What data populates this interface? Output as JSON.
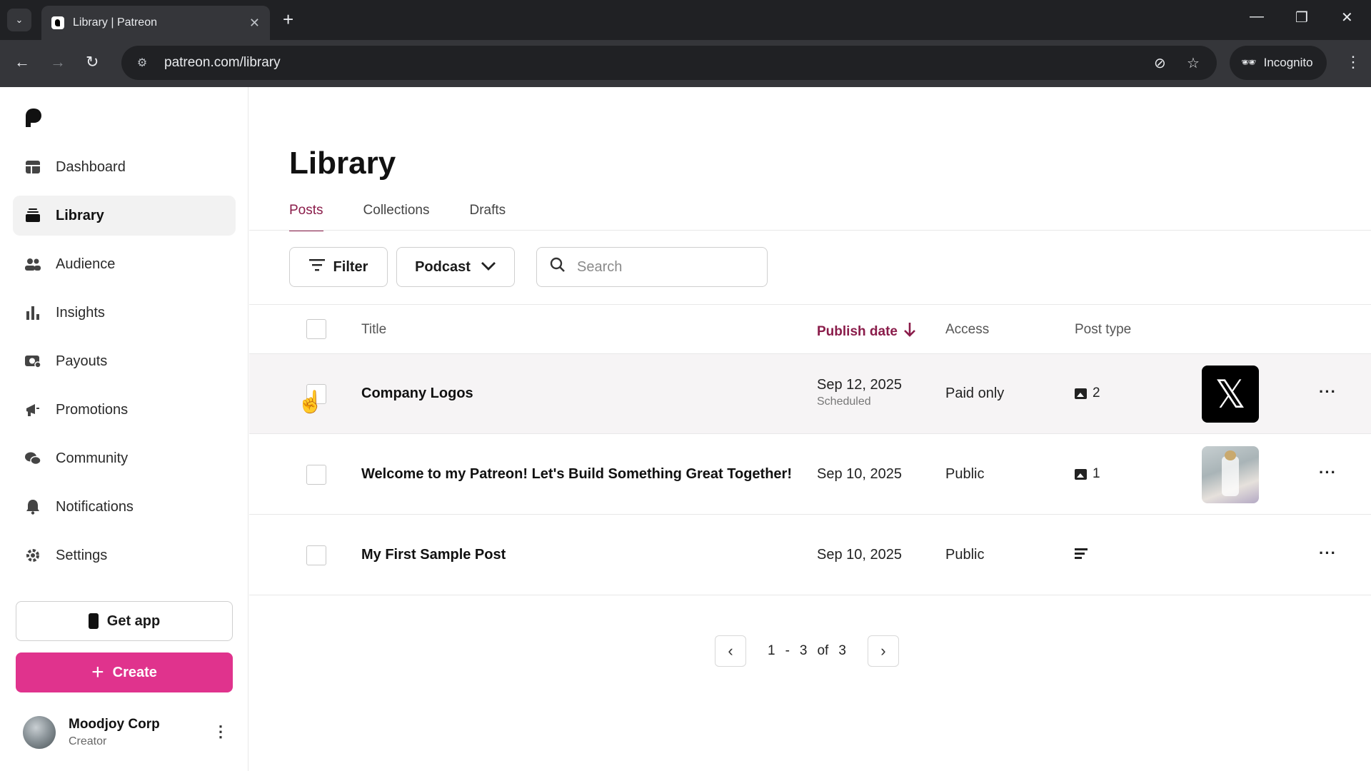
{
  "browser": {
    "tab_title": "Library | Patreon",
    "url": "patreon.com/library",
    "incognito_label": "Incognito"
  },
  "sidebar": {
    "items": [
      {
        "label": "Dashboard",
        "icon": "dashboard-icon"
      },
      {
        "label": "Library",
        "icon": "library-icon",
        "active": true
      },
      {
        "label": "Audience",
        "icon": "audience-icon"
      },
      {
        "label": "Insights",
        "icon": "insights-icon"
      },
      {
        "label": "Payouts",
        "icon": "payouts-icon"
      },
      {
        "label": "Promotions",
        "icon": "promotions-icon"
      },
      {
        "label": "Community",
        "icon": "community-icon"
      },
      {
        "label": "Notifications",
        "icon": "notifications-icon"
      },
      {
        "label": "Settings",
        "icon": "settings-icon"
      }
    ],
    "get_app_label": "Get app",
    "create_label": "Create",
    "user": {
      "name": "Moodjoy Corp",
      "role": "Creator"
    }
  },
  "main": {
    "title": "Library",
    "tabs": [
      {
        "label": "Posts",
        "active": true
      },
      {
        "label": "Collections"
      },
      {
        "label": "Drafts"
      }
    ],
    "filter_label": "Filter",
    "podcast_label": "Podcast",
    "search_placeholder": "Search",
    "columns": {
      "title": "Title",
      "publish_date": "Publish date",
      "access": "Access",
      "post_type": "Post type"
    },
    "rows": [
      {
        "title": "Company Logos",
        "date": "Sep 12, 2025",
        "status": "Scheduled",
        "access": "Paid only",
        "type_icon": "image-icon",
        "type_count": "2",
        "thumb": "x-logo"
      },
      {
        "title": "Welcome to my Patreon! Let's Build Something Great Together!",
        "date": "Sep 10, 2025",
        "status": "",
        "access": "Public",
        "type_icon": "image-icon",
        "type_count": "1",
        "thumb": "photo"
      },
      {
        "title": "My First Sample Post",
        "date": "Sep 10, 2025",
        "status": "",
        "access": "Public",
        "type_icon": "text-post-icon",
        "type_count": "",
        "thumb": ""
      }
    ],
    "pagination": {
      "from": "1",
      "dash": "-",
      "to": "3",
      "of": "of",
      "total": "3"
    }
  },
  "colors": {
    "accent": "#8a1c4a",
    "create": "#e0338d",
    "chrome_dark": "#202124",
    "chrome_toolbar": "#35363a"
  }
}
